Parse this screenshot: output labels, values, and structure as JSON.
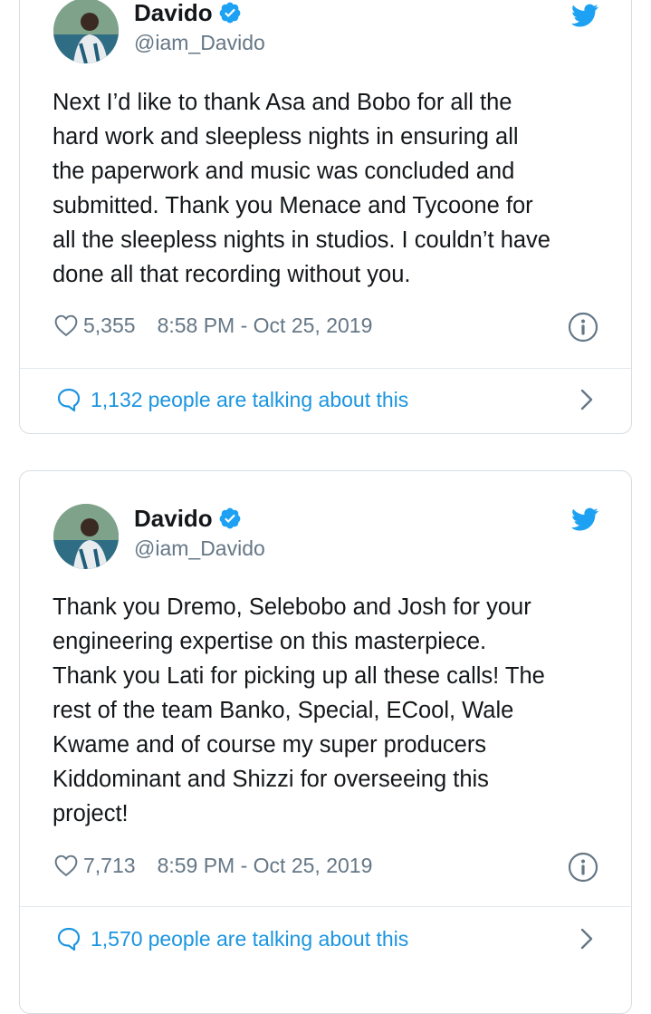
{
  "tweets": [
    {
      "author": {
        "name": "Davido",
        "handle": "@iam_Davido",
        "verified": true
      },
      "text": "Next I’d like to thank Asa and Bobo for all the\nhard work and sleepless nights in ensuring all\nthe paperwork and music was concluded and\nsubmitted. Thank you Menace and Tycoone for\nall the sleepless nights in studios. I couldn’t have\ndone all that recording without you.",
      "likes": "5,355",
      "timestamp": "8:58 PM - Oct 25, 2019",
      "talking_count": "1,132",
      "talking_label": "people are talking about this"
    },
    {
      "author": {
        "name": "Davido",
        "handle": "@iam_Davido",
        "verified": true
      },
      "text": "Thank you Dremo, Selebobo and Josh for your\nengineering expertise on this masterpiece.\nThank you Lati for picking up all these calls! The\nrest of the team Banko, Special, ECool, Wale\nKwame and of course my super producers\nKiddominant and Shizzi for overseeing this\nproject!",
      "likes": "7,713",
      "timestamp": "8:59 PM - Oct 25, 2019",
      "talking_count": "1,570",
      "talking_label": "people are talking about this"
    }
  ],
  "icons": {
    "verified": "verified-badge-icon",
    "brand": "twitter-bird-icon",
    "like": "heart-icon",
    "info": "info-icon",
    "reply": "speech-bubble-icon",
    "chevron": "chevron-right-icon"
  },
  "colors": {
    "twitter_blue": "#1da1f2",
    "link_blue": "#1b95e0",
    "secondary_text": "#657786",
    "border": "#d7dde2"
  }
}
